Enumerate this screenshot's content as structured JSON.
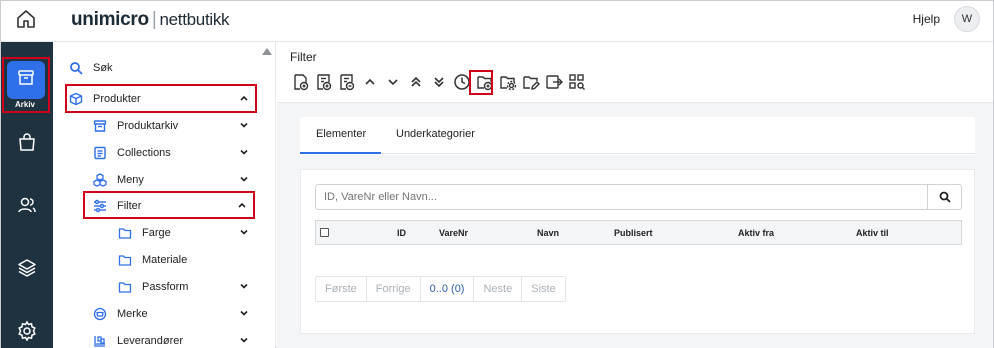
{
  "header": {
    "brand_main": "unimicro",
    "brand_sub": "nettbutikk",
    "help_label": "Hjelp",
    "avatar_initial": "W"
  },
  "rail": {
    "active_label": "Arkiv",
    "accent": "#2f6fe8",
    "background": "#1f3240",
    "items": [
      "archive-icon",
      "shopping-bag-icon",
      "users-icon",
      "layers-icon",
      "settings-icon"
    ]
  },
  "sidebar": {
    "items": [
      {
        "label": "Søk",
        "icon": "search-icon"
      },
      {
        "label": "Produkter",
        "icon": "cube-icon",
        "expanded": true
      },
      {
        "label": "Produktarkiv",
        "icon": "archive-icon"
      },
      {
        "label": "Collections",
        "icon": "collection-icon"
      },
      {
        "label": "Meny",
        "icon": "cubes-icon"
      },
      {
        "label": "Filter",
        "icon": "sliders-icon",
        "expanded": true
      },
      {
        "label": "Farge",
        "icon": "folder-icon"
      },
      {
        "label": "Materiale",
        "icon": "folder-icon"
      },
      {
        "label": "Passform",
        "icon": "folder-icon"
      },
      {
        "label": "Merke",
        "icon": "brand-icon"
      },
      {
        "label": "Leverandører",
        "icon": "supplier-icon"
      }
    ]
  },
  "main": {
    "title": "Filter",
    "toolbar": [
      "add-doc-icon",
      "add-list-icon",
      "remove-list-icon",
      "chevron-up-icon",
      "chevron-down-icon",
      "double-chevron-up-icon",
      "double-chevron-down-icon",
      "clock-icon",
      "add-folder-icon",
      "folder-settings-icon",
      "folder-edit-icon",
      "export-icon",
      "qr-search-icon"
    ],
    "tabs": [
      {
        "label": "Elementer",
        "active": true
      },
      {
        "label": "Underkategorier",
        "active": false
      }
    ],
    "search": {
      "placeholder": "ID, VareNr eller Navn..."
    },
    "columns": [
      "ID",
      "VareNr",
      "Navn",
      "Publisert",
      "Aktiv fra",
      "Aktiv til"
    ],
    "pager": {
      "first": "Første",
      "prev": "Forrige",
      "current": "0..0 (0)",
      "next": "Neste",
      "last": "Siste"
    }
  }
}
